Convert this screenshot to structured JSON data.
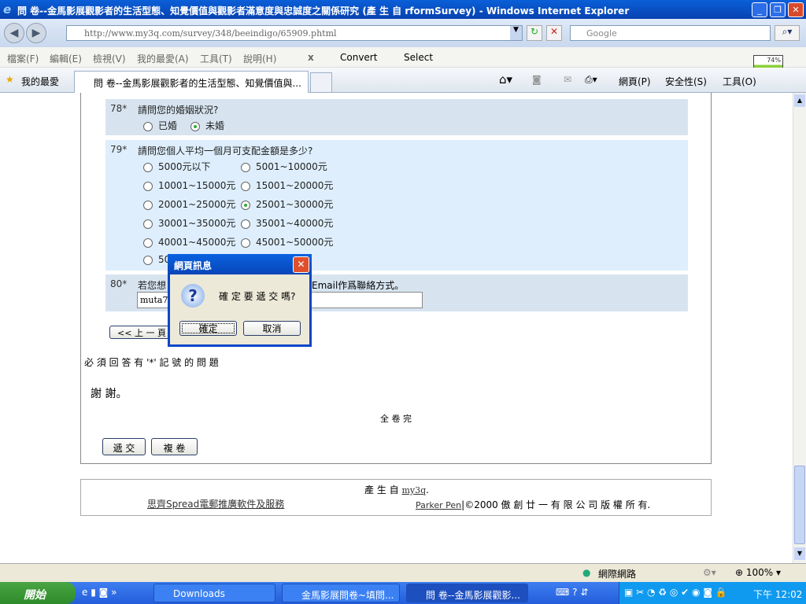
{
  "window": {
    "title": "問 卷--金馬影展觀影者的生活型態、知覺價值與觀影者滿意度與忠誠度之關係研究 (產 生 自 rformSurvey) - Windows Internet Explorer"
  },
  "address": {
    "url": "http://www.my3q.com/survey/348/beeindigo/65909.phtml",
    "search_placeholder": "Google"
  },
  "menu": [
    "檔案(F)",
    "編輯(E)",
    "檢視(V)",
    "我的最愛(A)",
    "工具(T)",
    "說明(H)"
  ],
  "toolbar": {
    "close": "x",
    "convert": "Convert",
    "select": "Select",
    "battery": "74%"
  },
  "tabs": {
    "favorites": "我的最愛",
    "active_tab": "問 卷--金馬影展觀影者的生活型態、知覺價值與...",
    "page": "網頁(P)",
    "safety": "安全性(S)",
    "tools": "工具(O)"
  },
  "survey": {
    "q78": {
      "num": "78*",
      "text": "請問您的婚姻狀況?",
      "options": [
        "已婚",
        "未婚"
      ],
      "selected": "未婚"
    },
    "q79": {
      "num": "79*",
      "text": "請問您個人平均一個月可支配金額是多少?",
      "options": [
        "5000元以下",
        "5001~10000元",
        "10001~15000元",
        "15001~20000元",
        "20001~25000元",
        "25001~30000元",
        "30001~35000元",
        "35001~40000元",
        "40001~45000元",
        "45001~50000元",
        "50"
      ],
      "selected": "25001~30000元"
    },
    "q80": {
      "num": "80*",
      "text_start": "若您想",
      "text_end": "Email作爲聯絡方式。",
      "value": "muta70"
    },
    "prev_button": "<< 上 一 頁",
    "required_note": "必 須 回 答 有 '*' 記 號 的 問 題",
    "thanks": "謝 謝。",
    "end": "全 卷 完",
    "submit": "遞 交",
    "copy": "複 卷"
  },
  "footer": {
    "generated": "產 生 自",
    "my3q": "my3q",
    "dot": ".",
    "spread_link": "思齊Spread電郵推廣軟件及服務",
    "parker_link": "Parker Pen",
    "copyright": "|©2000 傲 創 廿 一 有 限 公 司 版 權 所 有."
  },
  "dialog": {
    "title": "網頁訊息",
    "message": "確 定 要 遞 交 嗎?",
    "ok": "確定",
    "cancel": "取消"
  },
  "status": {
    "zone": "網際網路",
    "zoom": "100%"
  },
  "taskbar": {
    "start": "開始",
    "tasks": [
      "Downloads",
      "金馬影展問卷~填問...",
      "問 卷--金馬影展觀影..."
    ],
    "clock": "下午 12:02"
  }
}
